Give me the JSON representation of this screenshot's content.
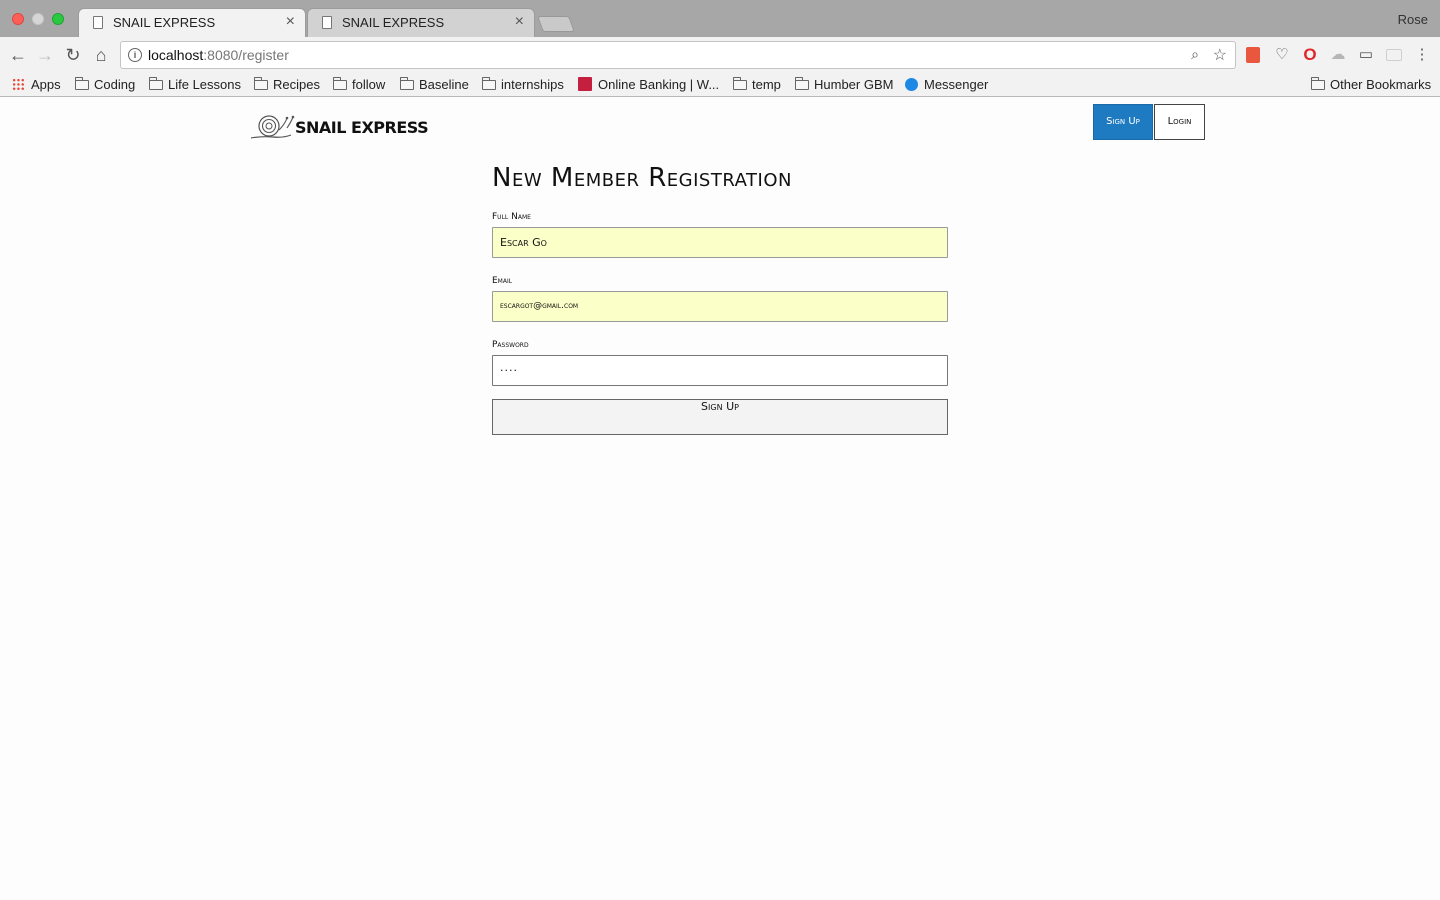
{
  "browser": {
    "tabs": [
      {
        "title": "SNAIL EXPRESS",
        "active": true
      },
      {
        "title": "SNAIL EXPRESS",
        "active": false
      }
    ],
    "profile_name": "Rose",
    "address": {
      "host": "localhost",
      "rest": ":8080/register"
    },
    "bookmarks": [
      {
        "label": "Apps",
        "icon": "apps-icon"
      },
      {
        "label": "Coding",
        "icon": "folder-icon"
      },
      {
        "label": "Life Lessons",
        "icon": "folder-icon"
      },
      {
        "label": "Recipes",
        "icon": "folder-icon"
      },
      {
        "label": "follow",
        "icon": "folder-icon"
      },
      {
        "label": "Baseline",
        "icon": "folder-icon"
      },
      {
        "label": "internships",
        "icon": "folder-icon"
      },
      {
        "label": "Online Banking | W...",
        "icon": "bank-icon"
      },
      {
        "label": "temp",
        "icon": "folder-icon"
      },
      {
        "label": "Humber GBM",
        "icon": "folder-icon"
      },
      {
        "label": "Messenger",
        "icon": "messenger-icon"
      }
    ],
    "other_bookmarks": "Other Bookmarks"
  },
  "header": {
    "logo_text": "SNAIL EXPRESS",
    "signup_label": "Sign Up",
    "login_label": "Login",
    "accent_color": "#1e7bc1"
  },
  "form": {
    "title": "New Member Registration",
    "fields": [
      {
        "label": "Full Name",
        "value": "Escar Go"
      },
      {
        "label": "Email",
        "value": "escargot@gmail.com"
      },
      {
        "label": "Password",
        "value": "····"
      }
    ],
    "submit_label": "Sign Up"
  }
}
